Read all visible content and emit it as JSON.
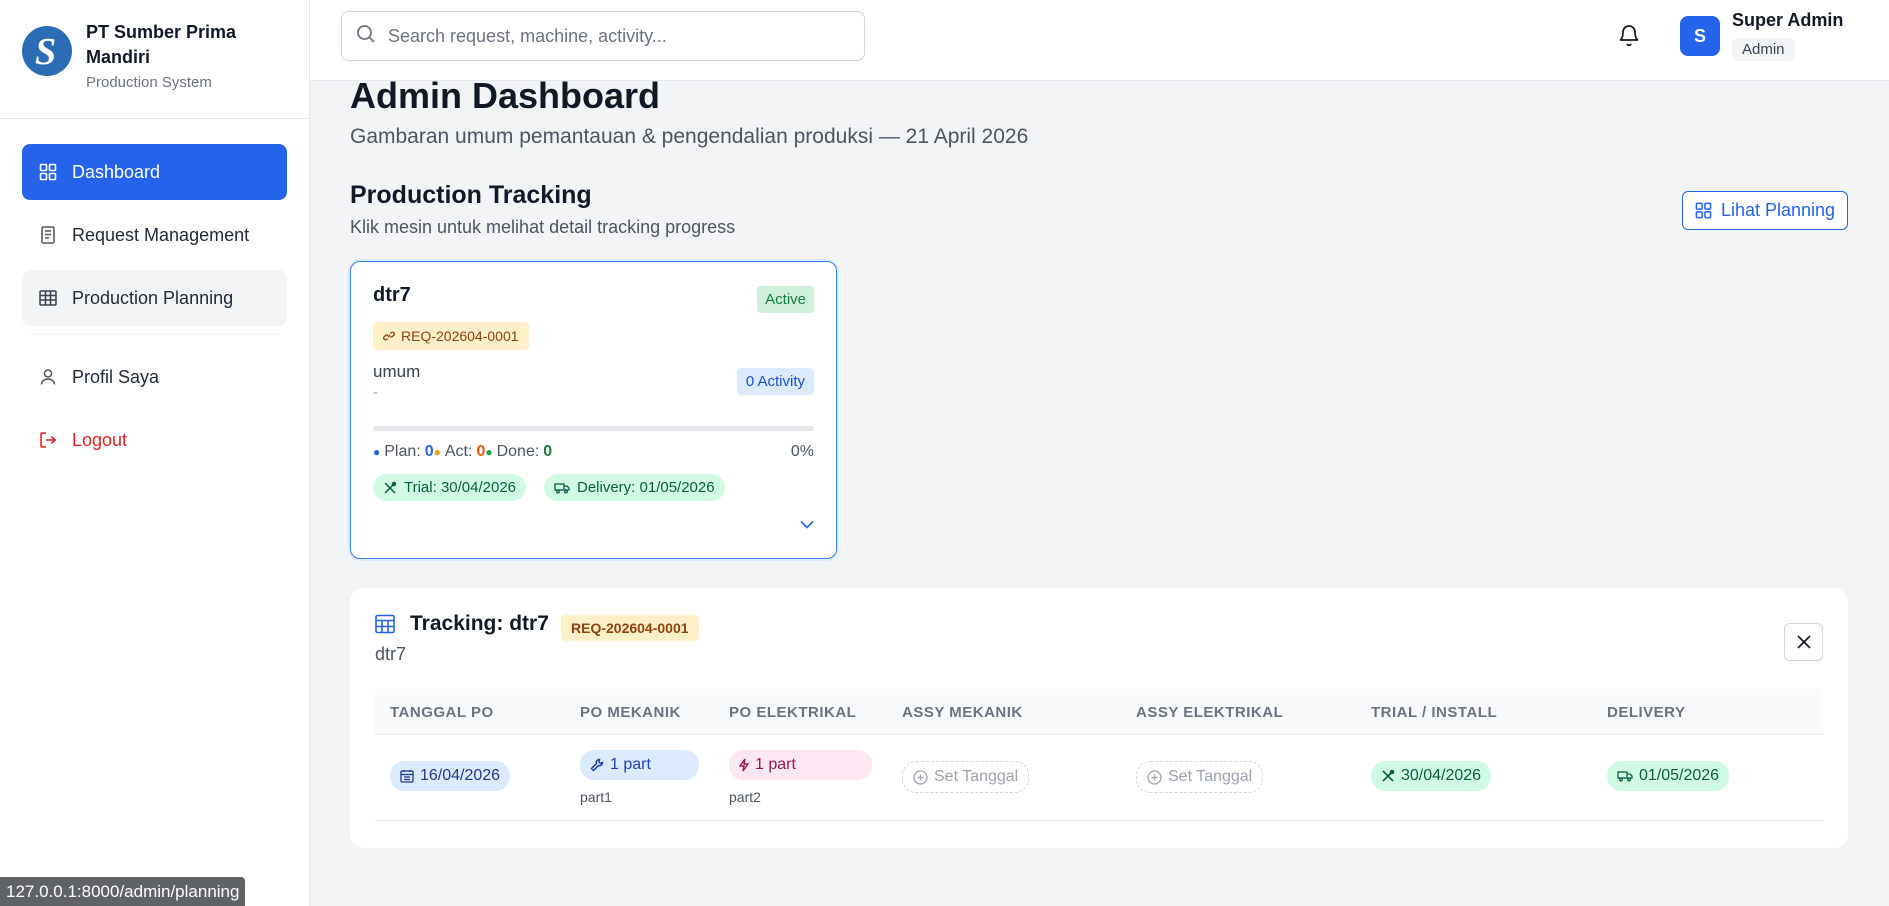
{
  "brand": {
    "name": "PT Sumber Prima Mandiri",
    "subtitle": "Production System",
    "logo_letter": "S"
  },
  "sidebar": {
    "items": [
      {
        "label": "Dashboard",
        "icon": "grid-icon",
        "state": "active"
      },
      {
        "label": "Request Management",
        "icon": "document-icon",
        "state": "normal"
      },
      {
        "label": "Production Planning",
        "icon": "table-icon",
        "state": "hover"
      },
      {
        "label": "Profil Saya",
        "icon": "user-icon",
        "state": "normal"
      },
      {
        "label": "Logout",
        "icon": "logout-icon",
        "state": "danger"
      }
    ]
  },
  "topbar": {
    "search_placeholder": "Search request, machine, activity...",
    "user_initial": "S",
    "user_name": "Super Admin",
    "user_role": "Admin"
  },
  "page": {
    "title": "Admin Dashboard",
    "subtitle": "Gambaran umum pemantauan & pengendalian produksi — 21 April 2026"
  },
  "tracking_section": {
    "title": "Production Tracking",
    "subtitle": "Klik mesin untuk melihat detail tracking progress",
    "planning_button": "Lihat Planning"
  },
  "machine_card": {
    "name": "dtr7",
    "status": "Active",
    "request_id": "REQ-202604-0001",
    "category": "umum",
    "category_sub": "-",
    "activity_badge": "0 Activity",
    "progress": 0,
    "plan_label": "Plan:",
    "plan_value": "0",
    "act_label": "Act:",
    "act_value": "0",
    "done_label": "Done:",
    "done_value": "0",
    "percent": "0%",
    "trial": "Trial: 30/04/2026",
    "delivery": "Delivery: 01/05/2026"
  },
  "tracking_panel": {
    "title": "Tracking: dtr7",
    "request_id": "REQ-202604-0001",
    "subtitle": "dtr7",
    "columns": [
      "TANGGAL PO",
      "PO MEKANIK",
      "PO ELEKTRIKAL",
      "ASSY MEKANIK",
      "ASSY ELEKTRIKAL",
      "TRIAL / INSTALL",
      "DELIVERY"
    ],
    "row": {
      "tanggal_po": "16/04/2026",
      "po_mekanik": "1 part",
      "po_mekanik_sub": "part1",
      "po_elektrikal": "1 part",
      "po_elektrikal_sub": "part2",
      "assy_mekanik": "Set Tanggal",
      "assy_elektrikal": "Set Tanggal",
      "trial_install": "30/04/2026",
      "delivery": "01/05/2026"
    }
  },
  "statusbar": {
    "url": "127.0.0.1:8000/admin/planning"
  },
  "colors": {
    "primary": "#2563eb",
    "danger": "#dc2626",
    "success": "#15803d",
    "warning_bg": "#fdf0c9"
  }
}
